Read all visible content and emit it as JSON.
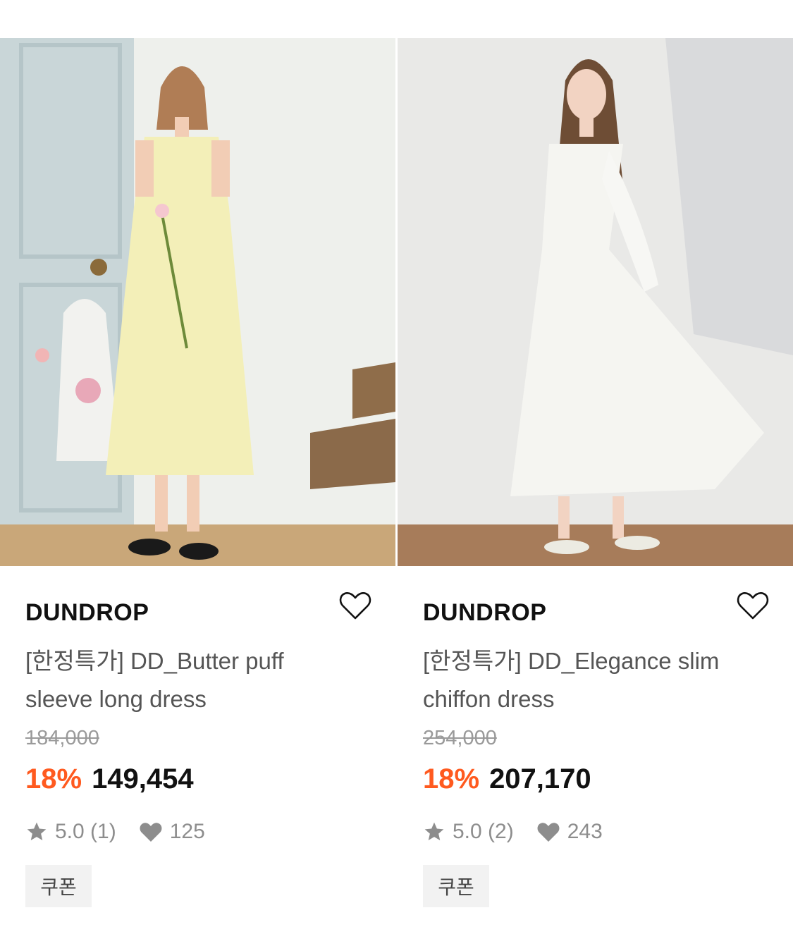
{
  "products": [
    {
      "image_alt": "photo",
      "brand": "DUNDROP",
      "title": "[한정특가] DD_Butter puff sleeve long dress",
      "original_price": "184,000",
      "discount": "18%",
      "price": "149,454",
      "rating": "5.0 (1)",
      "likes": "125",
      "coupon": "쿠폰"
    },
    {
      "image_alt": "photo",
      "brand": "DUNDROP",
      "title": "[한정특가] DD_Elegance slim chiffon dress",
      "original_price": "254,000",
      "discount": "18%",
      "price": "207,170",
      "rating": "5.0 (2)",
      "likes": "243",
      "coupon": "쿠폰"
    }
  ],
  "colors": {
    "discount": "#ff5a1f",
    "muted": "#8d8d8d",
    "coupon_bg": "#f2f2f2"
  }
}
